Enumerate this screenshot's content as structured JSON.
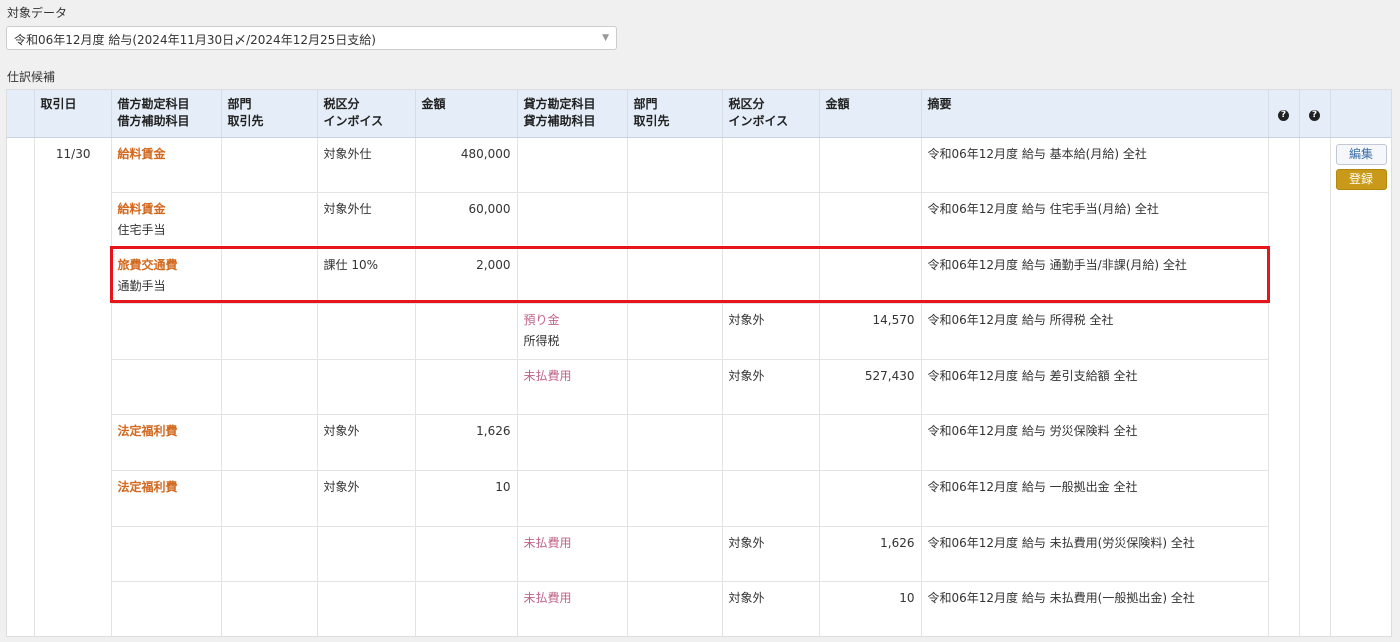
{
  "target": {
    "label": "対象データ",
    "selected": "令和06年12月度 給与(2024年11月30日〆/2024年12月25日支給)"
  },
  "candidates_label": "仕訳候補",
  "headers": {
    "date": "取引日",
    "debit_account": "借方勘定科目",
    "debit_sub": "借方補助科目",
    "dept1": "部門",
    "partner1": "取引先",
    "tax1": "税区分",
    "invoice1": "インボイス",
    "amount1": "金額",
    "credit_account": "貸方勘定科目",
    "credit_sub": "貸方補助科目",
    "dept2": "部門",
    "partner2": "取引先",
    "tax2": "税区分",
    "invoice2": "インボイス",
    "amount2": "金額",
    "memo": "摘要",
    "help1": "?",
    "help2": "?"
  },
  "date": "11/30",
  "buttons": {
    "edit": "編集",
    "register": "登録"
  },
  "rows": [
    {
      "debit_account": "給料賃金",
      "debit_sub": "",
      "debit_tax": "対象外仕",
      "debit_amount": "480,000",
      "credit_account": "",
      "credit_sub": "",
      "credit_tax": "",
      "credit_amount": "",
      "memo": "令和06年12月度 給与 基本給(月給) 全社"
    },
    {
      "debit_account": "給料賃金",
      "debit_sub": "住宅手当",
      "debit_tax": "対象外仕",
      "debit_amount": "60,000",
      "credit_account": "",
      "credit_sub": "",
      "credit_tax": "",
      "credit_amount": "",
      "memo": "令和06年12月度 給与 住宅手当(月給) 全社"
    },
    {
      "debit_account": "旅費交通費",
      "debit_sub": "通勤手当",
      "debit_tax": "課仕 10%",
      "debit_amount": "2,000",
      "credit_account": "",
      "credit_sub": "",
      "credit_tax": "",
      "credit_amount": "",
      "memo": "令和06年12月度 給与 通勤手当/非課(月給) 全社"
    },
    {
      "debit_account": "",
      "debit_sub": "",
      "debit_tax": "",
      "debit_amount": "",
      "credit_account": "預り金",
      "credit_sub": "所得税",
      "credit_tax": "対象外",
      "credit_amount": "14,570",
      "memo": "令和06年12月度 給与 所得税 全社"
    },
    {
      "debit_account": "",
      "debit_sub": "",
      "debit_tax": "",
      "debit_amount": "",
      "credit_account": "未払費用",
      "credit_sub": "",
      "credit_tax": "対象外",
      "credit_amount": "527,430",
      "memo": "令和06年12月度 給与 差引支給額 全社"
    },
    {
      "debit_account": "法定福利費",
      "debit_sub": "",
      "debit_tax": "対象外",
      "debit_amount": "1,626",
      "credit_account": "",
      "credit_sub": "",
      "credit_tax": "",
      "credit_amount": "",
      "memo": "令和06年12月度 給与 労災保険料 全社"
    },
    {
      "debit_account": "法定福利費",
      "debit_sub": "",
      "debit_tax": "対象外",
      "debit_amount": "10",
      "credit_account": "",
      "credit_sub": "",
      "credit_tax": "",
      "credit_amount": "",
      "memo": "令和06年12月度 給与 一般拠出金 全社"
    },
    {
      "debit_account": "",
      "debit_sub": "",
      "debit_tax": "",
      "debit_amount": "",
      "credit_account": "未払費用",
      "credit_sub": "",
      "credit_tax": "対象外",
      "credit_amount": "1,626",
      "memo": "令和06年12月度 給与 未払費用(労災保険料) 全社"
    },
    {
      "debit_account": "",
      "debit_sub": "",
      "debit_tax": "",
      "debit_amount": "",
      "credit_account": "未払費用",
      "credit_sub": "",
      "credit_tax": "対象外",
      "credit_amount": "10",
      "memo": "令和06年12月度 給与 未払費用(一般拠出金) 全社"
    }
  ],
  "colors": {
    "header_bg": "#e5eef8",
    "debit_account": "#d2691e",
    "credit_account": "#c0648a",
    "register_button": "#c99a1a",
    "highlight_border": "#e8141c"
  }
}
